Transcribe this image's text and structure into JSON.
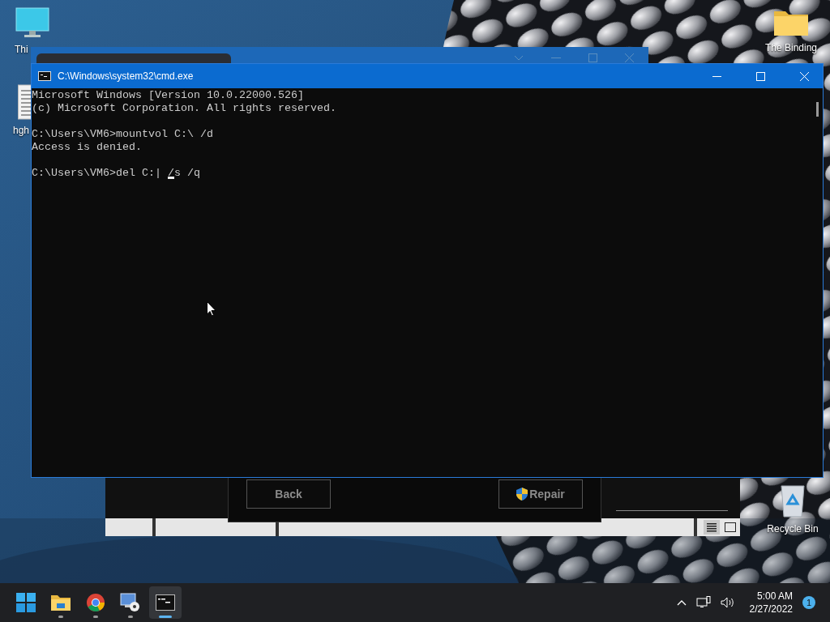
{
  "desktop": {
    "icons": [
      {
        "label": "Thi",
        "kind": "monitor"
      },
      {
        "label": "hgh",
        "kind": "document"
      },
      {
        "label": "The Binding",
        "kind": "folder"
      },
      {
        "label": "Recycle Bin",
        "kind": "recycle"
      }
    ]
  },
  "background_window": {
    "buttons": [
      {
        "label": "Back",
        "kind": "plain"
      },
      {
        "label": "Repair",
        "kind": "shield"
      }
    ]
  },
  "console_window": {
    "title": "C:\\Windows\\system32\\cmd.exe",
    "blocks": [
      [
        "Microsoft Windows [Version 10.0.22000.526]",
        "(c) Microsoft Corporation. All rights reserved."
      ],
      [
        "C:\\Users\\VM6>mountvol C:\\ /d",
        "Access is denied."
      ],
      [
        "C:\\Users\\VM6>del C:| /s /q"
      ]
    ]
  },
  "taskbar": {
    "apps": [
      {
        "kind": "start",
        "running": false,
        "selected": false
      },
      {
        "kind": "folder",
        "running": true,
        "selected": false
      },
      {
        "kind": "browser",
        "running": true,
        "selected": false
      },
      {
        "kind": "remote",
        "running": true,
        "selected": false
      },
      {
        "kind": "terminal",
        "running": true,
        "selected": true
      }
    ],
    "time": "5:00 AM",
    "date": "2/27/2022",
    "notification_count": "1"
  }
}
